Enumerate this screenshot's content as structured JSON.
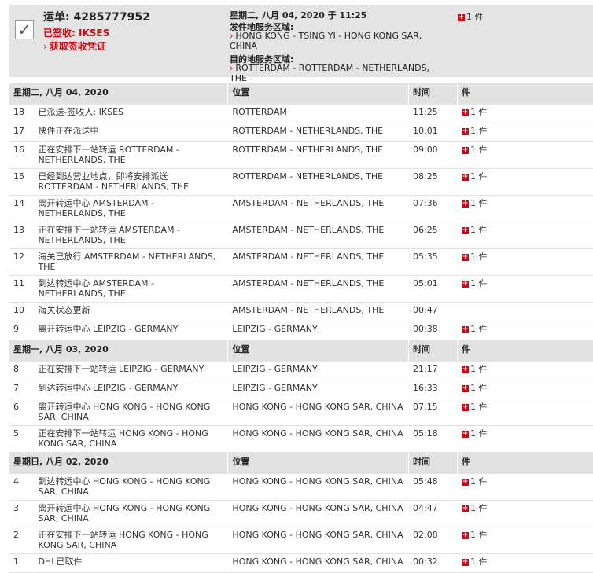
{
  "summary": {
    "waybill": "运单: 4285777952",
    "status": "已签收: IKSES",
    "proof_link": "获取签收凭证",
    "date_time": "星期二, 八月 04, 2020 于 11:25",
    "origin_label": "发件地服务区域:",
    "origin_value": "HONG KONG - TSING YI - HONG KONG SAR, CHINA",
    "destination_label": "目的地服务区域:",
    "destination_value": "ROTTERDAM - ROTTERDAM - NETHERLANDS, THE",
    "pieces": "1 件"
  },
  "columns": {
    "location": "位置",
    "time": "时间",
    "pieces": "件"
  },
  "days": [
    {
      "date": "星期二, 八月 04, 2020",
      "events": [
        {
          "num": "18",
          "desc": "已派送-签收人: IKSES",
          "loc": "ROTTERDAM",
          "time": "11:25",
          "pieces": "1 件"
        },
        {
          "num": "17",
          "desc": "快件正在派送中",
          "loc": "ROTTERDAM - NETHERLANDS, THE",
          "time": "10:01",
          "pieces": "1 件"
        },
        {
          "num": "16",
          "desc": "正在安排下一站转运 ROTTERDAM - NETHERLANDS, THE",
          "loc": "ROTTERDAM - NETHERLANDS, THE",
          "time": "09:00",
          "pieces": "1 件"
        },
        {
          "num": "15",
          "desc": "已经到达营业地点，即将安排派送 ROTTERDAM - NETHERLANDS, THE",
          "loc": "ROTTERDAM - NETHERLANDS, THE",
          "time": "08:25",
          "pieces": "1 件"
        },
        {
          "num": "14",
          "desc": "离开转运中心 AMSTERDAM - NETHERLANDS, THE",
          "loc": "AMSTERDAM - NETHERLANDS, THE",
          "time": "07:36",
          "pieces": "1 件"
        },
        {
          "num": "13",
          "desc": "正在安排下一站转运 AMSTERDAM - NETHERLANDS, THE",
          "loc": "AMSTERDAM - NETHERLANDS, THE",
          "time": "06:25",
          "pieces": "1 件"
        },
        {
          "num": "12",
          "desc": "海关已放行 AMSTERDAM - NETHERLANDS, THE",
          "loc": "AMSTERDAM - NETHERLANDS, THE",
          "time": "05:35",
          "pieces": "1 件"
        },
        {
          "num": "11",
          "desc": "到达转运中心 AMSTERDAM - NETHERLANDS, THE",
          "loc": "AMSTERDAM - NETHERLANDS, THE",
          "time": "05:01",
          "pieces": "1 件"
        },
        {
          "num": "10",
          "desc": "海关状态更新",
          "loc": "AMSTERDAM - NETHERLANDS, THE",
          "time": "00:47",
          "pieces": ""
        },
        {
          "num": "9",
          "desc": "离开转运中心 LEIPZIG - GERMANY",
          "loc": "LEIPZIG - GERMANY",
          "time": "00:38",
          "pieces": "1 件"
        }
      ]
    },
    {
      "date": "星期一, 八月 03, 2020",
      "events": [
        {
          "num": "8",
          "desc": "正在安排下一站转运 LEIPZIG - GERMANY",
          "loc": "LEIPZIG - GERMANY",
          "time": "21:17",
          "pieces": "1 件"
        },
        {
          "num": "7",
          "desc": "到达转运中心 LEIPZIG - GERMANY",
          "loc": "LEIPZIG - GERMANY",
          "time": "16:33",
          "pieces": "1 件"
        },
        {
          "num": "6",
          "desc": "离开转运中心 HONG KONG - HONG KONG SAR, CHINA",
          "loc": "HONG KONG - HONG KONG SAR, CHINA",
          "time": "07:15",
          "pieces": "1 件"
        },
        {
          "num": "5",
          "desc": "正在安排下一站转运 HONG KONG - HONG KONG SAR, CHINA",
          "loc": "HONG KONG - HONG KONG SAR, CHINA",
          "time": "05:18",
          "pieces": "1 件"
        }
      ]
    },
    {
      "date": "星期日, 八月 02, 2020",
      "events": [
        {
          "num": "4",
          "desc": "到达转运中心 HONG KONG - HONG KONG SAR, CHINA",
          "loc": "HONG KONG - HONG KONG SAR, CHINA",
          "time": "05:48",
          "pieces": "1 件"
        },
        {
          "num": "3",
          "desc": "离开转运中心 HONG KONG - HONG KONG SAR, CHINA",
          "loc": "HONG KONG - HONG KONG SAR, CHINA",
          "time": "04:47",
          "pieces": "1 件"
        },
        {
          "num": "2",
          "desc": "正在安排下一站转运 HONG KONG - HONG KONG SAR, CHINA",
          "loc": "HONG KONG - HONG KONG SAR, CHINA",
          "time": "02:08",
          "pieces": "1 件"
        },
        {
          "num": "1",
          "desc": "DHL已取件",
          "loc": "HONG KONG - HONG KONG SAR, CHINA",
          "time": "00:32",
          "pieces": "1 件"
        }
      ]
    }
  ],
  "icons": {
    "status_check": "checkmark-icon",
    "expand_pieces": "plus-icon",
    "link_arrow": "chevron-right-icon"
  },
  "colors": {
    "accent_red": "#d40511",
    "header_gray": "#e4e4e4"
  }
}
